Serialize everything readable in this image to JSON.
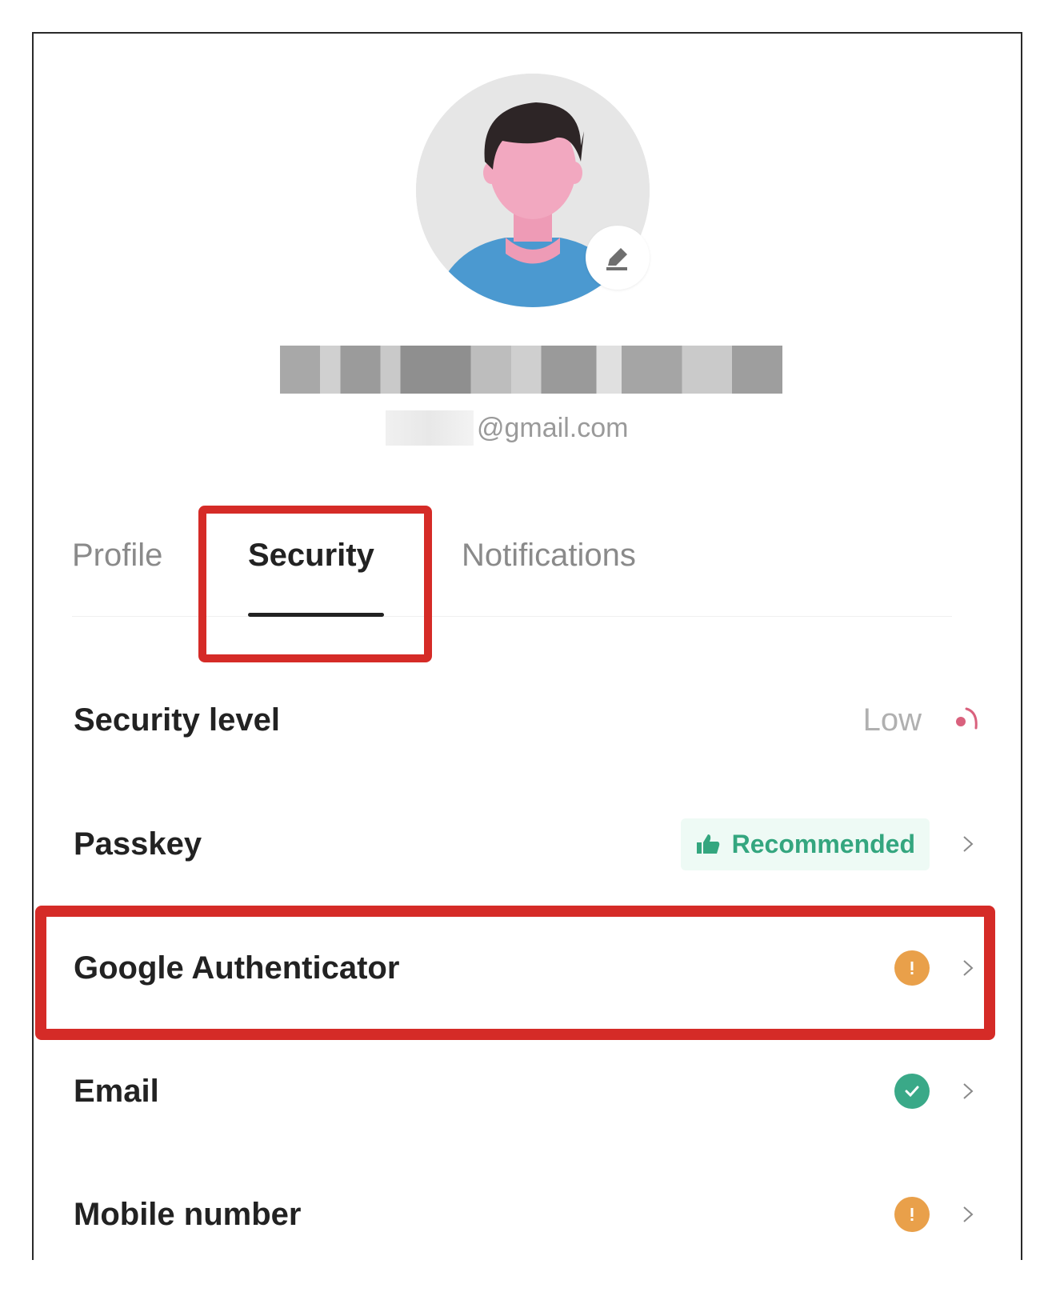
{
  "user": {
    "email_suffix": "@gmail.com"
  },
  "tabs": [
    {
      "label": "Profile",
      "active": false
    },
    {
      "label": "Security",
      "active": true
    },
    {
      "label": "Notifications",
      "active": false
    }
  ],
  "security": {
    "level_label": "Security level",
    "level_value": "Low",
    "items": [
      {
        "label": "Passkey",
        "badge": "Recommended",
        "status_icon": "thumbs-up-icon"
      },
      {
        "label": "Google Authenticator",
        "status_icon": "warning-icon"
      },
      {
        "label": "Email",
        "status_icon": "check-icon"
      },
      {
        "label": "Mobile number",
        "status_icon": "warning-icon"
      }
    ]
  },
  "colors": {
    "highlight": "#d52b27",
    "success": "#3aa988",
    "warning": "#e9a04a",
    "recommended_text": "#34a67f",
    "danger_icon": "#d9617d"
  }
}
